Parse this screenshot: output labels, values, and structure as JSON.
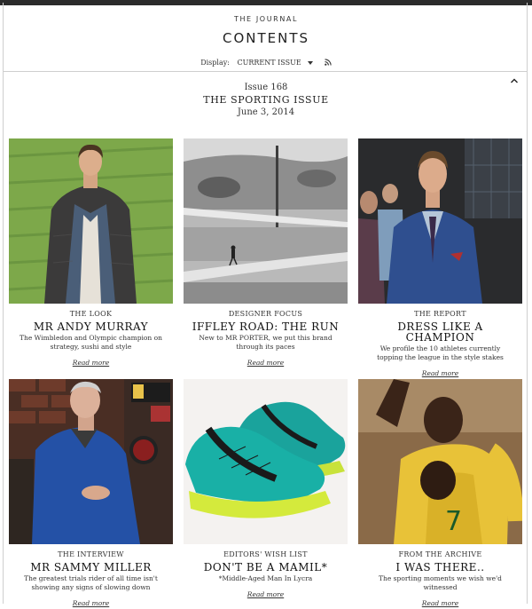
{
  "header": {
    "brand": "THE JOURNAL",
    "title": "CONTENTS",
    "display_label": "Display:",
    "display_value": "CURRENT ISSUE"
  },
  "issue": {
    "number": "Issue 168",
    "name": "THE SPORTING ISSUE",
    "date": "June 3, 2014"
  },
  "articles": [
    {
      "kicker": "THE LOOK",
      "headline": "MR ANDY MURRAY",
      "description": "The Wimbledon and Olympic champion on strategy, sushi and style",
      "more": "Read more"
    },
    {
      "kicker": "DESIGNER FOCUS",
      "headline": "IFFLEY ROAD: THE RUN",
      "description": "New to MR PORTER, we put this brand through its paces",
      "more": "Read more"
    },
    {
      "kicker": "THE REPORT",
      "headline": "DRESS LIKE A CHAMPION",
      "description": "We profile the 10 athletes currently topping the league in the style stakes",
      "more": "Read more"
    },
    {
      "kicker": "THE INTERVIEW",
      "headline": "MR SAMMY MILLER",
      "description": "The greatest trials rider of all time isn't showing any signs of slowing down",
      "more": "Read more"
    },
    {
      "kicker": "EDITORS' WISH LIST",
      "headline": "DON'T BE A MAMIL*",
      "description": "*Middle-Aged Man In Lycra",
      "more": "Read more"
    },
    {
      "kicker": "FROM THE ARCHIVE",
      "headline": "I WAS THERE..",
      "description": "The sporting moments we wish we'd witnessed",
      "more": "Read more"
    }
  ],
  "colors": {
    "top_bar": "#2b2b2b",
    "divider": "#cfcfcf",
    "text": "#222222"
  },
  "icons": {
    "dropdown": "caret-down-icon",
    "feed": "rss-icon",
    "collapse": "chevron-up-icon"
  }
}
